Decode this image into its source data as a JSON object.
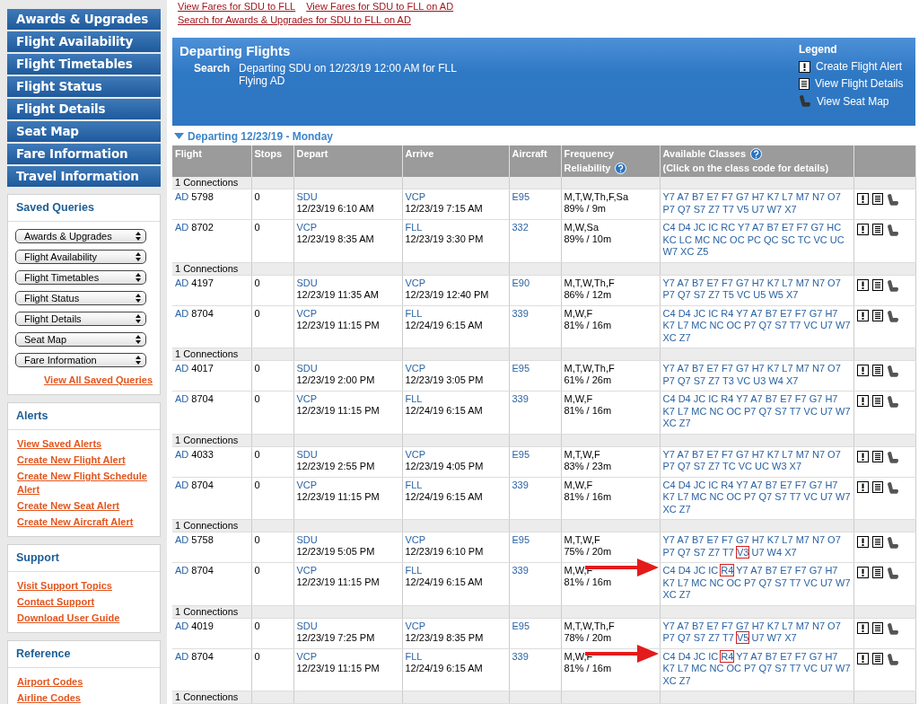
{
  "sidebar": {
    "nav": [
      "Awards & Upgrades",
      "Flight Availability",
      "Flight Timetables",
      "Flight Status",
      "Flight Details",
      "Seat Map",
      "Fare Information",
      "Travel Information"
    ],
    "panels": [
      {
        "title": "Saved Queries",
        "selects": [
          "Awards & Upgrades",
          "Flight Availability",
          "Flight Timetables",
          "Flight Status",
          "Flight Details",
          "Seat Map",
          "Fare Information"
        ],
        "footer_link": "View All Saved Queries"
      },
      {
        "title": "Alerts",
        "links": [
          "View Saved Alerts",
          "Create New Flight Alert",
          "Create New Flight Schedule Alert",
          "Create New Seat Alert",
          "Create New Aircraft Alert"
        ]
      },
      {
        "title": "Support",
        "links": [
          "Visit Support Topics",
          "Contact Support",
          "Download User Guide"
        ]
      },
      {
        "title": "Reference",
        "links": [
          "Airport Codes",
          "Airline Codes"
        ]
      }
    ]
  },
  "top_links": [
    [
      "View Fares for SDU to FLL",
      "View Fares for SDU to FLL on AD"
    ],
    [
      "Search for Awards & Upgrades for SDU to FLL on AD"
    ]
  ],
  "header": {
    "title": "Departing Flights",
    "search_label": "Search",
    "search_lines": [
      "Departing SDU on 12/23/19 12:00 AM for FLL",
      "Flying AD"
    ],
    "legend": {
      "title": "Legend",
      "items": [
        {
          "kind": "alert",
          "label": "Create Flight Alert"
        },
        {
          "kind": "details",
          "label": "View Flight Details"
        },
        {
          "kind": "seat",
          "label": "View Seat Map"
        }
      ]
    }
  },
  "date_heading": {
    "label": "Departing 12/23/19 - Monday",
    "expanded": true
  },
  "table": {
    "columns": [
      {
        "lines": [
          "Flight"
        ],
        "help": false
      },
      {
        "lines": [
          "Stops"
        ],
        "help": false
      },
      {
        "lines": [
          "Depart"
        ],
        "help": false
      },
      {
        "lines": [
          "Arrive"
        ],
        "help": false
      },
      {
        "lines": [
          "Aircraft"
        ],
        "help": false
      },
      {
        "lines": [
          "Frequency",
          "Reliability"
        ],
        "help": true
      },
      {
        "lines": [
          "Available Classes",
          "(Click on the class code for details)"
        ],
        "help": true
      },
      {
        "help": false
      }
    ],
    "groups": [
      {
        "label": "1 Connections",
        "flights": [
          {
            "airline": "AD",
            "number": "5798",
            "stops": "0",
            "depart": {
              "airport": "SDU",
              "time": "12/23/19 6:10 AM"
            },
            "arrive": {
              "airport": "VCP",
              "time": "12/23/19 7:15 AM"
            },
            "aircraft": "E95",
            "frequency": "M,T,W,Th,F,Sa",
            "reliability": "89% / 9m",
            "arrow": false,
            "classes": [
              {
                "boxed": false,
                "codes": [
                  "Y7",
                  "A7",
                  "B7",
                  "E7",
                  "F7",
                  "G7",
                  "H7",
                  "K7",
                  "L7",
                  "M7",
                  "N7",
                  "O7",
                  "P7",
                  "Q7",
                  "S7",
                  "Z7",
                  "T7",
                  "V5",
                  "U7",
                  "W7",
                  "X7"
                ]
              }
            ]
          },
          {
            "airline": "AD",
            "number": "8702",
            "stops": "0",
            "depart": {
              "airport": "VCP",
              "time": "12/23/19 8:35 AM"
            },
            "arrive": {
              "airport": "FLL",
              "time": "12/23/19 3:30 PM"
            },
            "aircraft": "332",
            "frequency": "M,W,Sa",
            "reliability": "89% / 10m",
            "arrow": false,
            "classes": [
              {
                "boxed": false,
                "codes": [
                  "C4",
                  "D4",
                  "JC",
                  "IC",
                  "RC",
                  "Y7",
                  "A7",
                  "B7",
                  "E7",
                  "F7",
                  "G7",
                  "HC",
                  "KC",
                  "LC",
                  "MC",
                  "NC",
                  "OC",
                  "PC",
                  "QC",
                  "SC",
                  "TC",
                  "VC",
                  "UC",
                  "W7",
                  "XC",
                  "Z5"
                ]
              }
            ]
          }
        ]
      },
      {
        "label": "1 Connections",
        "flights": [
          {
            "airline": "AD",
            "number": "4197",
            "stops": "0",
            "depart": {
              "airport": "SDU",
              "time": "12/23/19 11:35 AM"
            },
            "arrive": {
              "airport": "VCP",
              "time": "12/23/19 12:40 PM"
            },
            "aircraft": "E90",
            "frequency": "M,T,W,Th,F",
            "reliability": "86% / 12m",
            "arrow": false,
            "classes": [
              {
                "boxed": false,
                "codes": [
                  "Y7",
                  "A7",
                  "B7",
                  "E7",
                  "F7",
                  "G7",
                  "H7",
                  "K7",
                  "L7",
                  "M7",
                  "N7",
                  "O7",
                  "P7",
                  "Q7",
                  "S7",
                  "Z7",
                  "T5",
                  "VC",
                  "U5",
                  "W5",
                  "X7"
                ]
              }
            ]
          },
          {
            "airline": "AD",
            "number": "8704",
            "stops": "0",
            "depart": {
              "airport": "VCP",
              "time": "12/23/19 11:15 PM"
            },
            "arrive": {
              "airport": "FLL",
              "time": "12/24/19 6:15 AM"
            },
            "aircraft": "339",
            "frequency": "M,W,F",
            "reliability": "81% / 16m",
            "arrow": false,
            "classes": [
              {
                "boxed": false,
                "codes": [
                  "C4",
                  "D4",
                  "JC",
                  "IC",
                  "R4",
                  "Y7",
                  "A7",
                  "B7",
                  "E7",
                  "F7",
                  "G7",
                  "H7",
                  "K7",
                  "L7",
                  "MC",
                  "NC",
                  "OC",
                  "P7",
                  "Q7",
                  "S7",
                  "T7",
                  "VC",
                  "U7",
                  "W7",
                  "XC",
                  "Z7"
                ]
              }
            ]
          }
        ]
      },
      {
        "label": "1 Connections",
        "flights": [
          {
            "airline": "AD",
            "number": "4017",
            "stops": "0",
            "depart": {
              "airport": "SDU",
              "time": "12/23/19 2:00 PM"
            },
            "arrive": {
              "airport": "VCP",
              "time": "12/23/19 3:05 PM"
            },
            "aircraft": "E95",
            "frequency": "M,T,W,Th,F",
            "reliability": "61% / 26m",
            "arrow": false,
            "classes": [
              {
                "boxed": false,
                "codes": [
                  "Y7",
                  "A7",
                  "B7",
                  "E7",
                  "F7",
                  "G7",
                  "H7",
                  "K7",
                  "L7",
                  "M7",
                  "N7",
                  "O7",
                  "P7",
                  "Q7",
                  "S7",
                  "Z7",
                  "T3",
                  "VC",
                  "U3",
                  "W4",
                  "X7"
                ]
              }
            ]
          },
          {
            "airline": "AD",
            "number": "8704",
            "stops": "0",
            "depart": {
              "airport": "VCP",
              "time": "12/23/19 11:15 PM"
            },
            "arrive": {
              "airport": "FLL",
              "time": "12/24/19 6:15 AM"
            },
            "aircraft": "339",
            "frequency": "M,W,F",
            "reliability": "81% / 16m",
            "arrow": false,
            "classes": [
              {
                "boxed": false,
                "codes": [
                  "C4",
                  "D4",
                  "JC",
                  "IC",
                  "R4",
                  "Y7",
                  "A7",
                  "B7",
                  "E7",
                  "F7",
                  "G7",
                  "H7",
                  "K7",
                  "L7",
                  "MC",
                  "NC",
                  "OC",
                  "P7",
                  "Q7",
                  "S7",
                  "T7",
                  "VC",
                  "U7",
                  "W7",
                  "XC",
                  "Z7"
                ]
              }
            ]
          }
        ]
      },
      {
        "label": "1 Connections",
        "flights": [
          {
            "airline": "AD",
            "number": "4033",
            "stops": "0",
            "depart": {
              "airport": "SDU",
              "time": "12/23/19 2:55 PM"
            },
            "arrive": {
              "airport": "VCP",
              "time": "12/23/19 4:05 PM"
            },
            "aircraft": "E95",
            "frequency": "M,T,W,F",
            "reliability": "83% / 23m",
            "arrow": false,
            "classes": [
              {
                "boxed": false,
                "codes": [
                  "Y7",
                  "A7",
                  "B7",
                  "E7",
                  "F7",
                  "G7",
                  "H7",
                  "K7",
                  "L7",
                  "M7",
                  "N7",
                  "O7",
                  "P7",
                  "Q7",
                  "S7",
                  "Z7",
                  "TC",
                  "VC",
                  "UC",
                  "W3",
                  "X7"
                ]
              }
            ]
          },
          {
            "airline": "AD",
            "number": "8704",
            "stops": "0",
            "depart": {
              "airport": "VCP",
              "time": "12/23/19 11:15 PM"
            },
            "arrive": {
              "airport": "FLL",
              "time": "12/24/19 6:15 AM"
            },
            "aircraft": "339",
            "frequency": "M,W,F",
            "reliability": "81% / 16m",
            "arrow": false,
            "classes": [
              {
                "boxed": false,
                "codes": [
                  "C4",
                  "D4",
                  "JC",
                  "IC",
                  "R4",
                  "Y7",
                  "A7",
                  "B7",
                  "E7",
                  "F7",
                  "G7",
                  "H7",
                  "K7",
                  "L7",
                  "MC",
                  "NC",
                  "OC",
                  "P7",
                  "Q7",
                  "S7",
                  "T7",
                  "VC",
                  "U7",
                  "W7",
                  "XC",
                  "Z7"
                ]
              }
            ]
          }
        ]
      },
      {
        "label": "1 Connections",
        "flights": [
          {
            "airline": "AD",
            "number": "5758",
            "stops": "0",
            "depart": {
              "airport": "SDU",
              "time": "12/23/19 5:05 PM"
            },
            "arrive": {
              "airport": "VCP",
              "time": "12/23/19 6:10 PM"
            },
            "aircraft": "E95",
            "frequency": "M,T,W,F",
            "reliability": "75% / 20m",
            "arrow": false,
            "classes": [
              {
                "boxed": false,
                "codes": [
                  "Y7",
                  "A7",
                  "B7",
                  "E7",
                  "F7",
                  "G7",
                  "H7",
                  "K7",
                  "L7",
                  "M7",
                  "N7",
                  "O7",
                  "P7",
                  "Q7",
                  "S7",
                  "Z7",
                  "T7"
                ]
              },
              {
                "boxed": true,
                "codes": [
                  "V3"
                ]
              },
              {
                "boxed": false,
                "codes": [
                  "U7",
                  "W4",
                  "X7"
                ]
              }
            ]
          },
          {
            "airline": "AD",
            "number": "8704",
            "stops": "0",
            "depart": {
              "airport": "VCP",
              "time": "12/23/19 11:15 PM"
            },
            "arrive": {
              "airport": "FLL",
              "time": "12/24/19 6:15 AM"
            },
            "aircraft": "339",
            "frequency": "M,W,F",
            "reliability": "81% / 16m",
            "arrow": true,
            "classes": [
              {
                "boxed": false,
                "codes": [
                  "C4",
                  "D4",
                  "JC",
                  "IC"
                ]
              },
              {
                "boxed": true,
                "codes": [
                  "R4"
                ]
              },
              {
                "boxed": false,
                "codes": [
                  "Y7",
                  "A7",
                  "B7",
                  "E7",
                  "F7",
                  "G7",
                  "H7",
                  "K7",
                  "L7",
                  "MC",
                  "NC",
                  "OC",
                  "P7",
                  "Q7",
                  "S7",
                  "T7",
                  "VC",
                  "U7",
                  "W7",
                  "XC",
                  "Z7"
                ]
              }
            ]
          }
        ]
      },
      {
        "label": "1 Connections",
        "flights": [
          {
            "airline": "AD",
            "number": "4019",
            "stops": "0",
            "depart": {
              "airport": "SDU",
              "time": "12/23/19 7:25 PM"
            },
            "arrive": {
              "airport": "VCP",
              "time": "12/23/19 8:35 PM"
            },
            "aircraft": "E95",
            "frequency": "M,T,W,Th,F",
            "reliability": "78% / 20m",
            "arrow": false,
            "classes": [
              {
                "boxed": false,
                "codes": [
                  "Y7",
                  "A7",
                  "B7",
                  "E7",
                  "F7",
                  "G7",
                  "H7",
                  "K7",
                  "L7",
                  "M7",
                  "N7",
                  "O7",
                  "P7",
                  "Q7",
                  "S7",
                  "Z7",
                  "T7"
                ]
              },
              {
                "boxed": true,
                "codes": [
                  "V5"
                ]
              },
              {
                "boxed": false,
                "codes": [
                  "U7",
                  "W7",
                  "X7"
                ]
              }
            ]
          },
          {
            "airline": "AD",
            "number": "8704",
            "stops": "0",
            "depart": {
              "airport": "VCP",
              "time": "12/23/19 11:15 PM"
            },
            "arrive": {
              "airport": "FLL",
              "time": "12/24/19 6:15 AM"
            },
            "aircraft": "339",
            "frequency": "M,W,F",
            "reliability": "81% / 16m",
            "arrow": true,
            "classes": [
              {
                "boxed": false,
                "codes": [
                  "C4",
                  "D4",
                  "JC",
                  "IC"
                ]
              },
              {
                "boxed": true,
                "codes": [
                  "R4"
                ]
              },
              {
                "boxed": false,
                "codes": [
                  "Y7",
                  "A7",
                  "B7",
                  "E7",
                  "F7",
                  "G7",
                  "H7",
                  "K7",
                  "L7",
                  "MC",
                  "NC",
                  "OC",
                  "P7",
                  "Q7",
                  "S7",
                  "T7",
                  "VC",
                  "U7",
                  "W7",
                  "XC",
                  "Z7"
                ]
              }
            ]
          }
        ]
      },
      {
        "label": "1 Connections"
      }
    ]
  }
}
